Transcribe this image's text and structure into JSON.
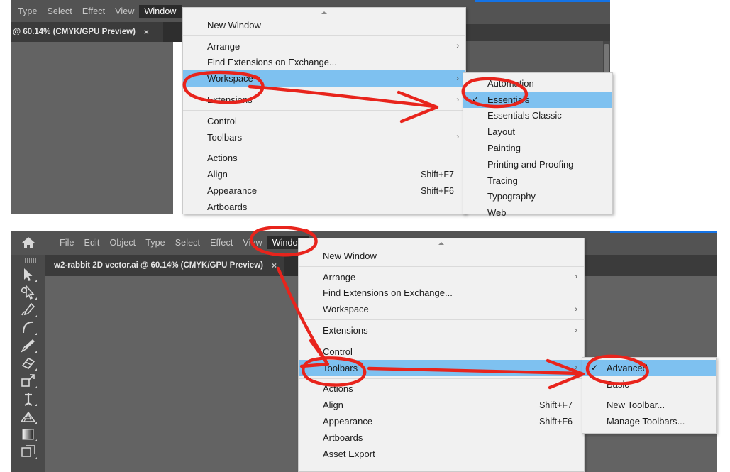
{
  "app": {
    "name": "Adobe Illustrator",
    "accent_blue": "#1473e6",
    "highlight_blue": "#7ec1f0",
    "annotation_red": "#e8241c",
    "menu_bg": "#f1f1f1",
    "chrome_dark": "#535353",
    "tabbar_dark": "#3b3b3b",
    "canvas_gray": "#636363"
  },
  "top_screenshot": {
    "menubar": {
      "items": [
        {
          "label": "Type",
          "active": false
        },
        {
          "label": "Select",
          "active": false
        },
        {
          "label": "Effect",
          "active": false
        },
        {
          "label": "View",
          "active": false
        },
        {
          "label": "Window",
          "active": true
        }
      ]
    },
    "document_tab": {
      "title": "@ 60.14% (CMYK/GPU Preview)",
      "close_label": "×"
    },
    "window_menu": {
      "groups": [
        {
          "items": [
            {
              "label": "New Window",
              "shortcut": "",
              "submenu": false,
              "highlight": false
            }
          ]
        },
        {
          "items": [
            {
              "label": "Arrange",
              "shortcut": "",
              "submenu": true,
              "highlight": false
            },
            {
              "label": "Find Extensions on Exchange...",
              "shortcut": "",
              "submenu": false,
              "highlight": false
            },
            {
              "label": "Workspace",
              "shortcut": "",
              "submenu": true,
              "highlight": true
            }
          ]
        },
        {
          "items": [
            {
              "label": "Extensions",
              "shortcut": "",
              "submenu": true,
              "highlight": false
            }
          ]
        },
        {
          "items": [
            {
              "label": "Control",
              "shortcut": "",
              "submenu": false,
              "highlight": false
            },
            {
              "label": "Toolbars",
              "shortcut": "",
              "submenu": true,
              "highlight": false
            }
          ]
        },
        {
          "items": [
            {
              "label": "Actions",
              "shortcut": "",
              "submenu": false,
              "highlight": false
            },
            {
              "label": "Align",
              "shortcut": "Shift+F7",
              "submenu": false,
              "highlight": false
            },
            {
              "label": "Appearance",
              "shortcut": "Shift+F6",
              "submenu": false,
              "highlight": false
            },
            {
              "label": "Artboards",
              "shortcut": "",
              "submenu": false,
              "highlight": false
            }
          ]
        }
      ]
    },
    "workspace_submenu": {
      "items": [
        {
          "label": "Automation",
          "checked": false,
          "highlight": false
        },
        {
          "label": "Essentials",
          "checked": true,
          "highlight": true
        },
        {
          "label": "Essentials Classic",
          "checked": false,
          "highlight": false
        },
        {
          "label": "Layout",
          "checked": false,
          "highlight": false
        },
        {
          "label": "Painting",
          "checked": false,
          "highlight": false
        },
        {
          "label": "Printing and Proofing",
          "checked": false,
          "highlight": false
        },
        {
          "label": "Tracing",
          "checked": false,
          "highlight": false
        },
        {
          "label": "Typography",
          "checked": false,
          "highlight": false
        },
        {
          "label": "Web",
          "checked": false,
          "highlight": false
        }
      ]
    },
    "annotations": [
      {
        "kind": "ellipse",
        "target": "Workspace"
      },
      {
        "kind": "arrow",
        "from": "Workspace",
        "to": "Essentials"
      },
      {
        "kind": "ellipse",
        "target": "Essentials"
      }
    ]
  },
  "bottom_screenshot": {
    "home_icon": "home-icon",
    "menubar": {
      "items": [
        {
          "label": "File",
          "active": false
        },
        {
          "label": "Edit",
          "active": false
        },
        {
          "label": "Object",
          "active": false
        },
        {
          "label": "Type",
          "active": false
        },
        {
          "label": "Select",
          "active": false
        },
        {
          "label": "Effect",
          "active": false
        },
        {
          "label": "View",
          "active": false
        },
        {
          "label": "Window",
          "active": true
        }
      ]
    },
    "document_tab": {
      "title": "w2-rabbit 2D vector.ai @ 60.14% (CMYK/GPU Preview)",
      "close_label": "×"
    },
    "tools": [
      "selection-tool-icon",
      "direct-selection-tool-icon",
      "pen-tool-icon",
      "curvature-tool-icon",
      "paintbrush-tool-icon",
      "eraser-tool-icon",
      "free-transform-tool-icon",
      "puppet-warp-tool-icon",
      "perspective-grid-tool-icon",
      "gradient-tool-icon",
      "artboard-tool-icon"
    ],
    "window_menu": {
      "groups": [
        {
          "items": [
            {
              "label": "New Window",
              "shortcut": "",
              "submenu": false,
              "highlight": false
            }
          ]
        },
        {
          "items": [
            {
              "label": "Arrange",
              "shortcut": "",
              "submenu": true,
              "highlight": false
            },
            {
              "label": "Find Extensions on Exchange...",
              "shortcut": "",
              "submenu": false,
              "highlight": false
            },
            {
              "label": "Workspace",
              "shortcut": "",
              "submenu": true,
              "highlight": false
            }
          ]
        },
        {
          "items": [
            {
              "label": "Extensions",
              "shortcut": "",
              "submenu": true,
              "highlight": false
            }
          ]
        },
        {
          "items": [
            {
              "label": "Control",
              "shortcut": "",
              "submenu": false,
              "highlight": false
            },
            {
              "label": "Toolbars",
              "shortcut": "",
              "submenu": true,
              "highlight": true
            }
          ]
        },
        {
          "items": [
            {
              "label": "Actions",
              "shortcut": "",
              "submenu": false,
              "highlight": false
            },
            {
              "label": "Align",
              "shortcut": "Shift+F7",
              "submenu": false,
              "highlight": false
            },
            {
              "label": "Appearance",
              "shortcut": "Shift+F6",
              "submenu": false,
              "highlight": false
            },
            {
              "label": "Artboards",
              "shortcut": "",
              "submenu": false,
              "highlight": false
            },
            {
              "label": "Asset Export",
              "shortcut": "",
              "submenu": false,
              "highlight": false
            }
          ]
        }
      ]
    },
    "toolbars_submenu": {
      "groups": [
        {
          "items": [
            {
              "label": "Advanced",
              "checked": true,
              "highlight": true
            },
            {
              "label": "Basic",
              "checked": false,
              "highlight": false
            }
          ]
        },
        {
          "items": [
            {
              "label": "New Toolbar...",
              "checked": false,
              "highlight": false
            },
            {
              "label": "Manage Toolbars...",
              "checked": false,
              "highlight": false
            }
          ]
        }
      ]
    },
    "annotations": [
      {
        "kind": "ellipse",
        "target": "Window"
      },
      {
        "kind": "arrow",
        "from": "Window",
        "to": "Toolbars"
      },
      {
        "kind": "ellipse",
        "target": "Toolbars"
      },
      {
        "kind": "arrow",
        "from": "Toolbars",
        "to": "Advanced"
      },
      {
        "kind": "ellipse",
        "target": "Advanced"
      }
    ]
  }
}
